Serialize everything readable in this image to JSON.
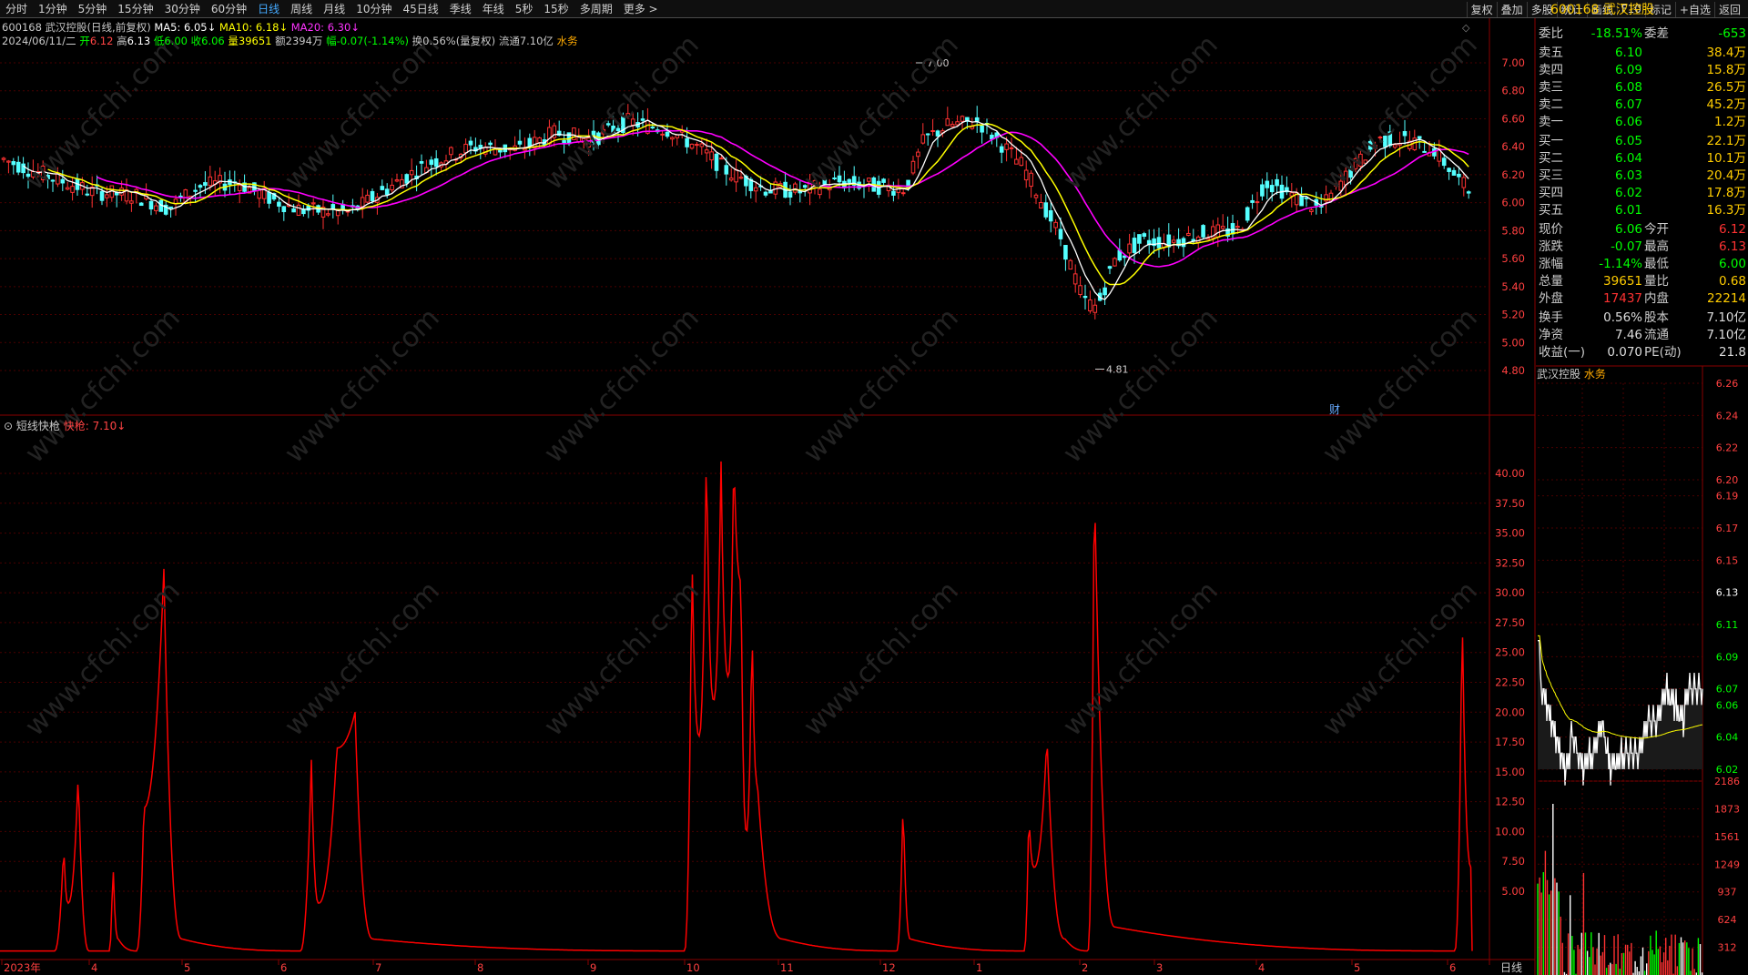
{
  "toolbar": {
    "periods": [
      "分时",
      "1分钟",
      "5分钟",
      "15分钟",
      "30分钟",
      "60分钟",
      "日线",
      "周线",
      "月线",
      "10分钟",
      "45日线",
      "季线",
      "年线",
      "5秒",
      "15秒",
      "多周期",
      "更多 >"
    ],
    "selected": "日线",
    "tools": [
      "复权",
      "叠加",
      "多股",
      "统计",
      "画线",
      "F10",
      "标记",
      "+自选",
      "返回"
    ]
  },
  "header": {
    "code_name": "600168 武汉控股(日线,前复权)",
    "ma5": "MA5: 6.05↓",
    "ma10": "MA10: 6.18↓",
    "ma20": "MA20: 6.30↓",
    "date": "2024/06/11/二",
    "open_label": "开",
    "open": "6.12",
    "high_label": "高",
    "high": "6.13",
    "low_label": "低",
    "low": "6.00",
    "close_label": "收",
    "close": "6.06",
    "vol_label": "量",
    "vol": "39651",
    "amount": "额2394万",
    "chg_label": "幅",
    "chg": "-0.07(-1.14%)",
    "turnover": "换0.56%(量复权)",
    "float_cap": "流通7.10亿",
    "sector": "水务"
  },
  "main_chart": {
    "ylim": [
      4.7,
      7.2
    ],
    "ticks": [
      "7.00",
      "6.80",
      "6.60",
      "6.40",
      "6.20",
      "6.00",
      "5.80",
      "5.60",
      "5.40",
      "5.20",
      "5.00",
      "4.80"
    ],
    "tick_values": [
      7.0,
      6.8,
      6.6,
      6.4,
      6.2,
      6.0,
      5.8,
      5.6,
      5.4,
      5.2,
      5.0,
      4.8
    ],
    "high_label": "7.00",
    "low_label": "4.81",
    "fin_marker": "财"
  },
  "indicator": {
    "name": "短线快枪",
    "line_label": "快枪: 7.10↓",
    "ticks": [
      "40.00",
      "37.50",
      "35.00",
      "32.50",
      "30.00",
      "27.50",
      "25.00",
      "22.50",
      "20.00",
      "17.50",
      "15.00",
      "12.50",
      "10.00",
      "7.50",
      "5.00"
    ],
    "tick_values": [
      40,
      37.5,
      35,
      32.5,
      30,
      27.5,
      25,
      22.5,
      20,
      17.5,
      15,
      12.5,
      10,
      7.5,
      5
    ]
  },
  "xaxis": {
    "labels": [
      "2023年",
      "4",
      "5",
      "6",
      "7",
      "8",
      "9",
      "10",
      "11",
      "12",
      "1",
      "2",
      "3",
      "4",
      "5",
      "6"
    ],
    "period_label": "日线"
  },
  "quote_panel": {
    "code": "600168",
    "name": "武汉控股",
    "ratio": {
      "label": "委比",
      "value": "-18.51%",
      "label2": "委差",
      "value2": "-653"
    },
    "asks": [
      {
        "label": "卖五",
        "price": "6.10",
        "vol": "38.4万"
      },
      {
        "label": "卖四",
        "price": "6.09",
        "vol": "15.8万"
      },
      {
        "label": "卖三",
        "price": "6.08",
        "vol": "26.5万"
      },
      {
        "label": "卖二",
        "price": "6.07",
        "vol": "45.2万"
      },
      {
        "label": "卖一",
        "price": "6.06",
        "vol": "1.2万"
      }
    ],
    "bids": [
      {
        "label": "买一",
        "price": "6.05",
        "vol": "22.1万"
      },
      {
        "label": "买二",
        "price": "6.04",
        "vol": "10.1万"
      },
      {
        "label": "买三",
        "price": "6.03",
        "vol": "20.4万"
      },
      {
        "label": "买四",
        "price": "6.02",
        "vol": "17.8万"
      },
      {
        "label": "买五",
        "price": "6.01",
        "vol": "16.3万"
      }
    ],
    "stats": [
      {
        "l1": "现价",
        "v1": "6.06",
        "l2": "今开",
        "v2": "6.12"
      },
      {
        "l1": "涨跌",
        "v1": "-0.07",
        "l2": "最高",
        "v2": "6.13"
      },
      {
        "l1": "涨幅",
        "v1": "-1.14%",
        "l2": "最低",
        "v2": "6.00"
      },
      {
        "l1": "总量",
        "v1": "39651",
        "l2": "量比",
        "v2": "0.68"
      },
      {
        "l1": "外盘",
        "v1": "17437",
        "l2": "内盘",
        "v2": "22214"
      }
    ],
    "stats2": [
      {
        "l1": "换手",
        "v1": "0.56%",
        "l2": "股本",
        "v2": "7.10亿"
      },
      {
        "l1": "净资",
        "v1": "7.46",
        "l2": "流通",
        "v2": "7.10亿"
      },
      {
        "l1": "收益(一)",
        "v1": "0.070",
        "l2": "PE(动)",
        "v2": "21.8"
      }
    ]
  },
  "mini_chart": {
    "title": "武汉控股",
    "sector": "水务",
    "price_ticks": [
      "6.26",
      "6.24",
      "6.22",
      "6.20",
      "6.19",
      "6.17",
      "6.15",
      "6.13",
      "6.11",
      "6.09",
      "6.07",
      "6.06",
      "6.04",
      "6.02"
    ],
    "price_tick_values": [
      6.26,
      6.24,
      6.22,
      6.2,
      6.19,
      6.17,
      6.15,
      6.13,
      6.11,
      6.09,
      6.07,
      6.06,
      6.04,
      6.02
    ],
    "prev_close": 6.13,
    "vol_ticks": [
      "2186",
      "1873",
      "1561",
      "1249",
      "937",
      "624",
      "312"
    ],
    "vol_tick_values": [
      2186,
      1873,
      1561,
      1249,
      937,
      624,
      312
    ]
  },
  "colors": {
    "up": "#ff3232",
    "down": "#54ffff",
    "ma5": "#ffffff",
    "ma10": "#ffff00",
    "ma20": "#ff00ff",
    "indicator": "#ff0000",
    "grid": "#4a0000"
  }
}
